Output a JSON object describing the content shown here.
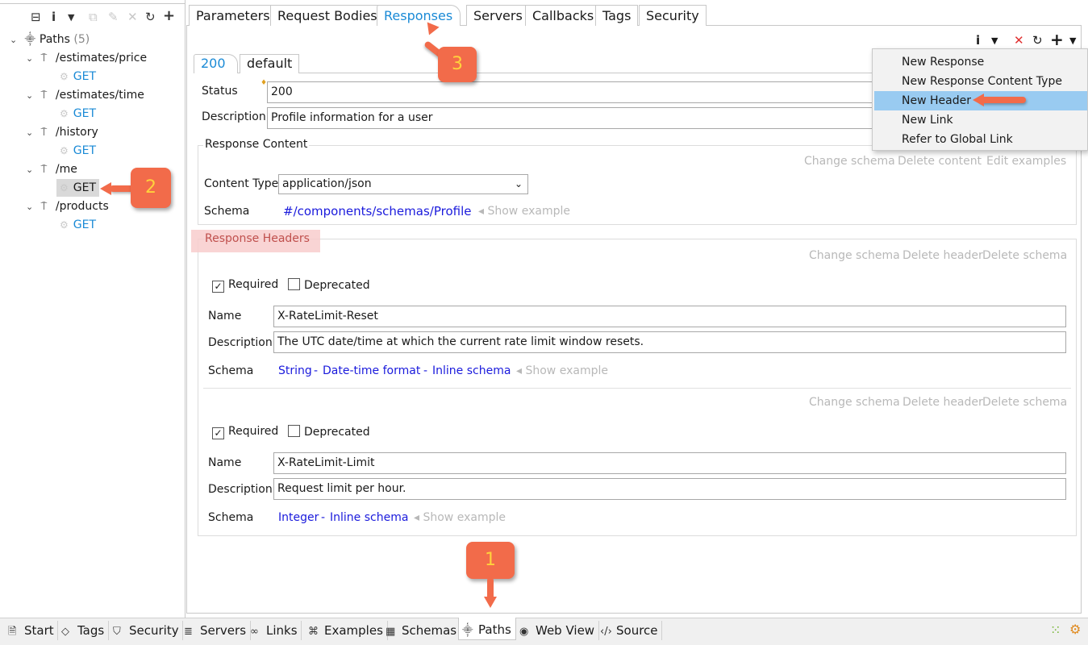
{
  "left_toolbar": {
    "icons": [
      "collapse-all-icon",
      "info-icon",
      "dropdown-icon",
      "copy-icon",
      "edit-icon",
      "delete-icon",
      "refresh-icon",
      "add-icon"
    ]
  },
  "tree": {
    "root_label": "Paths",
    "root_count": "(5)",
    "paths": [
      {
        "path": "/estimates/price",
        "method": "GET"
      },
      {
        "path": "/estimates/time",
        "method": "GET"
      },
      {
        "path": "/history",
        "method": "GET"
      },
      {
        "path": "/me",
        "method": "GET"
      },
      {
        "path": "/products",
        "method": "GET"
      }
    ]
  },
  "main_tabs": [
    "Parameters",
    "Request Bodies",
    "Responses",
    "Servers",
    "Callbacks",
    "Tags",
    "Security"
  ],
  "active_main_tab": "Responses",
  "response_tabs": [
    "200",
    "default"
  ],
  "active_response_tab": "200",
  "response": {
    "status_label": "Status",
    "status_value": "200",
    "description_label": "Description",
    "description_value": "Profile information for a user"
  },
  "response_content": {
    "title": "Response Content",
    "actions": [
      "Change schema",
      "Delete content",
      "Edit examples"
    ],
    "content_type_label": "Content Type",
    "content_type_value": "application/json",
    "schema_label": "Schema",
    "schema_value": "#/components/schemas/Profile",
    "show_example": "Show example"
  },
  "response_headers": {
    "title": "Response Headers",
    "headers": [
      {
        "actions": [
          "Change schema",
          "Delete header",
          "Delete schema"
        ],
        "required_label": "Required",
        "required": true,
        "deprecated_label": "Deprecated",
        "deprecated": false,
        "name_label": "Name",
        "name": "X-RateLimit-Reset",
        "description_label": "Description",
        "description": "The UTC date/time at which the current rate limit window resets.",
        "schema_label": "Schema",
        "schema_parts": [
          "String",
          "Date-time format",
          "Inline schema"
        ],
        "show_example": "Show example"
      },
      {
        "actions": [
          "Change schema",
          "Delete header",
          "Delete schema"
        ],
        "required_label": "Required",
        "required": true,
        "deprecated_label": "Deprecated",
        "deprecated": false,
        "name_label": "Name",
        "name": "X-RateLimit-Limit",
        "description_label": "Description",
        "description": "Request limit per hour.",
        "schema_label": "Schema",
        "schema_parts": [
          "Integer",
          "Inline schema"
        ],
        "show_example": "Show example"
      }
    ]
  },
  "context_menu": {
    "items": [
      "New Response",
      "New Response Content Type",
      "New Header",
      "New Link",
      "Refer to Global Link"
    ],
    "selected": "New Header"
  },
  "callouts": [
    "1",
    "2",
    "3"
  ],
  "bottom_tabs": [
    {
      "label": "Start",
      "icon": "document-icon"
    },
    {
      "label": "Tags",
      "icon": "tag-icon"
    },
    {
      "label": "Security",
      "icon": "shield-icon"
    },
    {
      "label": "Servers",
      "icon": "server-icon"
    },
    {
      "label": "Links",
      "icon": "link-icon"
    },
    {
      "label": "Examples",
      "icon": "examples-icon"
    },
    {
      "label": "Schemas",
      "icon": "schemas-icon"
    },
    {
      "label": "Paths",
      "icon": "paths-icon"
    },
    {
      "label": "Web View",
      "icon": "globe-icon"
    },
    {
      "label": "Source",
      "icon": "code-icon"
    }
  ],
  "active_bottom_tab": "Paths",
  "colors": {
    "accent_blue": "#1a8ad6",
    "link_blue": "#1a1adc",
    "callout_orange": "#f26b4a",
    "callout_text": "#ffd23c",
    "menu_selected": "#99cbf1"
  }
}
